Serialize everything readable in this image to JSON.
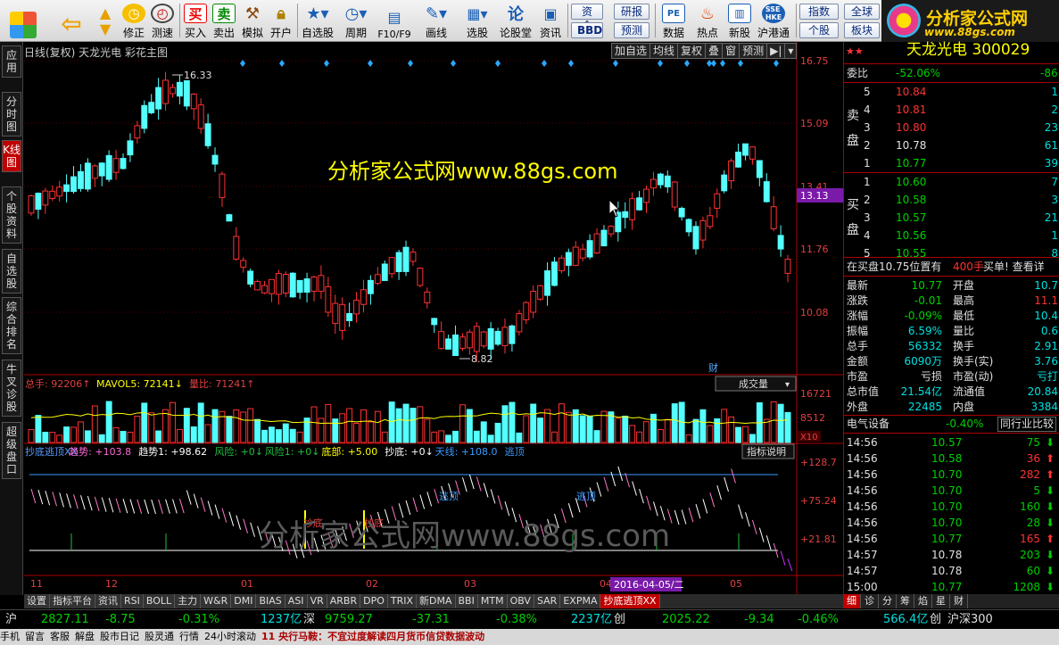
{
  "toolbar": {
    "buttons": [
      {
        "label": "",
        "icon": "app-grid-icon"
      },
      {
        "label": "",
        "icon": "back-arrow-icon"
      },
      {
        "label": "",
        "icon": "up-down-arrows-icon"
      },
      {
        "label": "修正",
        "icon": "clock-icon"
      },
      {
        "label": "测速",
        "icon": "speed-clock-icon"
      },
      {
        "label": "买入",
        "icon": "buy-icon",
        "glyph": "买"
      },
      {
        "label": "卖出",
        "icon": "sell-icon",
        "glyph": "卖"
      },
      {
        "label": "模拟",
        "icon": "hammer-icon"
      },
      {
        "label": "开户",
        "icon": "lock-icon"
      },
      {
        "label": "自选股",
        "icon": "star-folder-icon"
      },
      {
        "label": "周期",
        "icon": "clock-dropdown-icon"
      },
      {
        "label": "F10/F9",
        "icon": "document-icon"
      },
      {
        "label": "画线",
        "icon": "pencil-icon"
      },
      {
        "label": "选股",
        "icon": "select-stock-icon"
      },
      {
        "label": "论股堂",
        "icon": "lgt-icon"
      },
      {
        "label": "资讯",
        "icon": "info-icon"
      }
    ],
    "pills": [
      "资金",
      "研报",
      "BBD",
      "预测"
    ],
    "buttons2": [
      {
        "label": "数据",
        "icon": "pe-icon"
      },
      {
        "label": "热点",
        "icon": "hot-icon"
      },
      {
        "label": "新股",
        "icon": "new-stock-icon"
      },
      {
        "label": "沪港通",
        "icon": "sse-hke-icon"
      }
    ],
    "pills2": [
      "指数",
      "全球",
      "个股",
      "板块"
    ]
  },
  "logo": {
    "title": "分析家公式网",
    "url": "www.88gs.com"
  },
  "leftnav": [
    "应用",
    "分时图",
    "K线图",
    "个股资料",
    "自选股",
    "综合排名",
    "牛叉诊股",
    "超级盘口"
  ],
  "chart": {
    "title": "日线(复权)  天龙光电  彩花主图",
    "tags": [
      "加自选",
      "均线",
      "复权",
      "叠",
      "窗",
      "预测",
      "▶|"
    ],
    "watermark": "分析家公式网www.88gs.com",
    "watermark2": "分析家公式网www.88gs.com",
    "price_axis": [
      "16.75",
      "15.09",
      "13.41",
      "11.76",
      "10.08"
    ],
    "current_price": "13.13",
    "high_label": "16.33",
    "low_label": "8.82",
    "cai_label": "财",
    "vol_header": {
      "total": "总手: 92206",
      "mavol": "MAVOL5: 72141",
      "ratio": "量比: 71241"
    },
    "vol_dropdown": "成交量",
    "vol_axis": [
      "16721",
      "8512",
      "X10"
    ],
    "ind_header": {
      "name": "抄底逃顶XX",
      "trend": "趋势: +103.8",
      "trend1": "趋势1: +98.62",
      "risk": "风险: +0",
      "risk1": "风险1: +0",
      "bottom": "底部: +5.00",
      "chaodi": "抄底: +0",
      "tianxian": "天线: +108.0",
      "taoding": "逃顶"
    },
    "ind_button": "指标说明",
    "ind_axis": [
      "+128.7",
      "+75.24",
      "+21.81"
    ],
    "ind_marks": [
      "抄底",
      "抄底",
      "逃顶",
      "逃顶"
    ],
    "x_axis": [
      "11",
      "12",
      "01",
      "02",
      "03",
      "04",
      "05"
    ],
    "date_cursor": "2016-04-05/二"
  },
  "chart_data": {
    "type": "candlestick",
    "x_range": [
      "2015-11",
      "2016-05"
    ],
    "price_ylim": [
      8.82,
      16.75
    ],
    "notable": {
      "high": 16.33,
      "low": 8.82,
      "last": 13.13
    },
    "volume_ylim": [
      0,
      16721
    ],
    "indicator_ylim": [
      21.81,
      128.7
    ]
  },
  "quote": {
    "title": "天龙光电 300029",
    "weibi": {
      "label": "委比",
      "pct": "-52.06%",
      "val": "-86"
    },
    "sell": [
      {
        "n": "5",
        "p": "10.84",
        "v": "1"
      },
      {
        "n": "4",
        "p": "10.81",
        "v": "2"
      },
      {
        "n": "3",
        "p": "10.80",
        "v": "23"
      },
      {
        "n": "2",
        "p": "10.78",
        "v": "61"
      },
      {
        "n": "1",
        "p": "10.77",
        "v": "39"
      }
    ],
    "buy": [
      {
        "n": "1",
        "p": "10.60",
        "v": "7"
      },
      {
        "n": "2",
        "p": "10.58",
        "v": "3"
      },
      {
        "n": "3",
        "p": "10.57",
        "v": "21"
      },
      {
        "n": "4",
        "p": "10.56",
        "v": "1"
      },
      {
        "n": "5",
        "p": "10.55",
        "v": "8"
      }
    ],
    "sell_label": [
      "卖",
      "盘"
    ],
    "buy_label": [
      "买",
      "盘"
    ],
    "notice": {
      "text": "在买盘10.75位置有",
      "qty": "400手",
      "act": "买单! 查看详"
    },
    "stats": [
      [
        "最新",
        "10.77",
        "开盘",
        "10.7"
      ],
      [
        "涨跌",
        "-0.01",
        "最高",
        "11.1"
      ],
      [
        "涨幅",
        "-0.09%",
        "最低",
        "10.4"
      ],
      [
        "振幅",
        "6.59%",
        "量比",
        "0.6"
      ],
      [
        "总手",
        "56332",
        "换手",
        "2.91"
      ],
      [
        "金额",
        "6090万",
        "换手(实)",
        "3.76"
      ],
      [
        "市盈",
        "亏损",
        "市盈(动)",
        "亏打"
      ],
      [
        "总市值",
        "21.54亿",
        "流通值",
        "20.84"
      ],
      [
        "外盘",
        "22485",
        "内盘",
        "3384"
      ]
    ],
    "sector": {
      "name": "电气设备",
      "pct": "-0.40%",
      "btn": "同行业比较"
    },
    "ticks": [
      {
        "t": "14:56",
        "p": "10.57",
        "v": "75",
        "d": "down"
      },
      {
        "t": "14:56",
        "p": "10.58",
        "v": "36",
        "d": "up"
      },
      {
        "t": "14:56",
        "p": "10.70",
        "v": "282",
        "d": "up"
      },
      {
        "t": "14:56",
        "p": "10.70",
        "v": "5",
        "d": "down"
      },
      {
        "t": "14:56",
        "p": "10.70",
        "v": "160",
        "d": "down"
      },
      {
        "t": "14:56",
        "p": "10.70",
        "v": "28",
        "d": "down"
      },
      {
        "t": "14:56",
        "p": "10.77",
        "v": "165",
        "d": "up"
      },
      {
        "t": "14:57",
        "p": "10.78",
        "v": "203",
        "d": "down"
      },
      {
        "t": "14:57",
        "p": "10.78",
        "v": "60",
        "d": "down"
      },
      {
        "t": "15:00",
        "p": "10.77",
        "v": "1208",
        "d": "down"
      }
    ]
  },
  "tabs": [
    "设置",
    "指标平台",
    "资讯",
    "RSI",
    "BOLL",
    "主力",
    "W&R",
    "DMI",
    "BIAS",
    "ASI",
    "VR",
    "ARBR",
    "DPO",
    "TRIX",
    "新DMA",
    "BBI",
    "MTM",
    "OBV",
    "SAR",
    "EXPMA",
    "抄底逃顶XX"
  ],
  "rtabs": [
    "细",
    "诊",
    "分",
    "筹",
    "焰",
    "星",
    "财"
  ],
  "status": {
    "sh_label": "沪",
    "sh_idx": "2827.11",
    "sh_chg": "-8.75",
    "sh_pct": "-0.31%",
    "sh_amt": "1237亿",
    "sz_label": "深",
    "sz_idx": "9759.27",
    "sz_chg": "-37.31",
    "sz_pct": "-0.38%",
    "sz_amt": "2237亿",
    "cy_label": "创",
    "cy_idx": "2025.22",
    "cy_chg": "-9.34",
    "cy_pct": "-0.46%",
    "cy_amt": "566.4亿",
    "hs300": "沪深300"
  },
  "ticker": [
    "手机",
    "留言",
    "客服",
    "解盘",
    "股市日记",
    "股灵通",
    "行情",
    "24小时滚动",
    "11 央行马鞍：不宜过度解读四月货币信贷数据波动"
  ]
}
